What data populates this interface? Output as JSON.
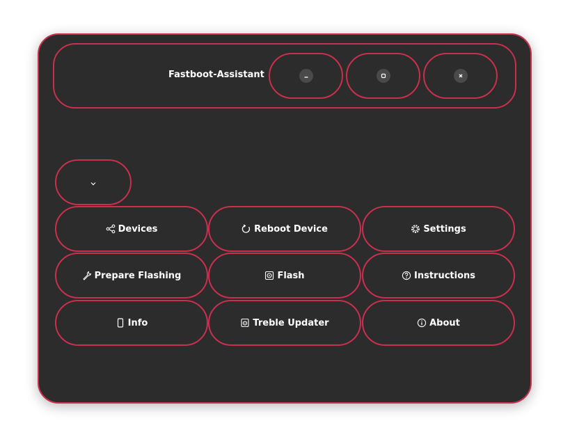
{
  "window": {
    "title": "Fastboot-Assistant",
    "controls": [
      {
        "name": "minimize-button",
        "icon": "minimize-icon"
      },
      {
        "name": "maximize-button",
        "icon": "maximize-icon"
      },
      {
        "name": "close-button",
        "icon": "close-icon"
      }
    ]
  },
  "dropdown": {
    "icon": "chevron-down-icon"
  },
  "buttons": [
    {
      "label": "Devices",
      "icon": "share-nodes-icon"
    },
    {
      "label": "Reboot Device",
      "icon": "reload-icon"
    },
    {
      "label": "Settings",
      "icon": "gear-icon"
    },
    {
      "label": "Prepare Flashing",
      "icon": "wrench-icon"
    },
    {
      "label": "Flash",
      "icon": "drive-icon"
    },
    {
      "label": "Instructions",
      "icon": "help-icon"
    },
    {
      "label": "Info",
      "icon": "phone-icon"
    },
    {
      "label": "Treble Updater",
      "icon": "disk-icon"
    },
    {
      "label": "About",
      "icon": "info-icon"
    }
  ],
  "colors": {
    "accent": "#c9304e",
    "background": "#2c2c2c",
    "text": "#ffffff"
  }
}
